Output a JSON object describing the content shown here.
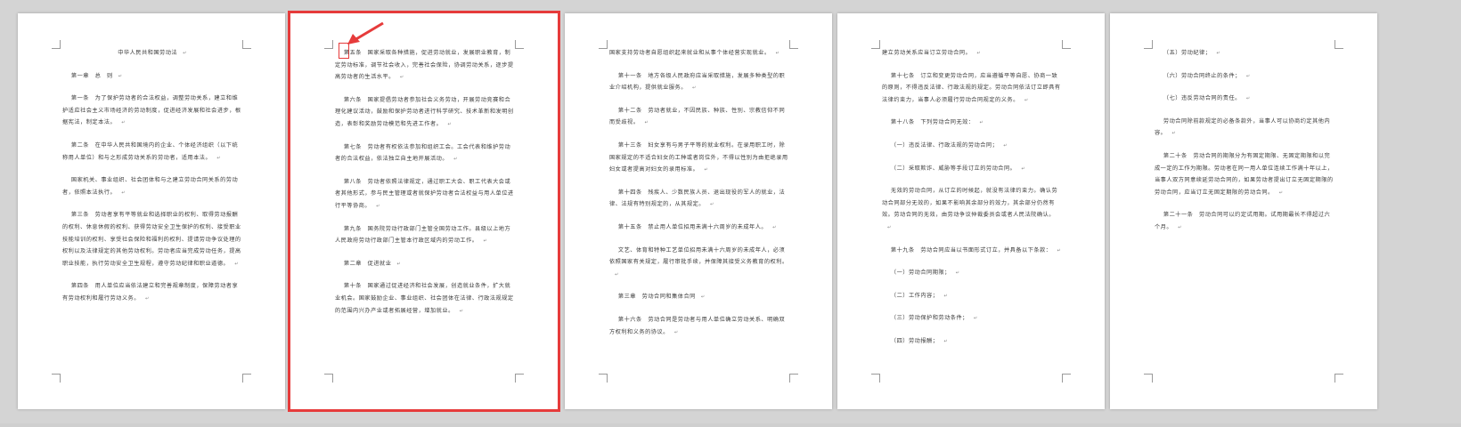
{
  "pages": [
    {
      "paragraphs": [
        "中华人民共和国劳动法",
        "第一章　总　则",
        "第一条　为了保护劳动者的合法权益，调整劳动关系，建立和维护适应社会主义市场经济的劳动制度，促进经济发展和社会进步，根据宪法，制定本法。",
        "第二条　在中华人民共和国境内的企业、个体经济组织（以下统称用人单位）和与之形成劳动关系的劳动者，适用本法。",
        "国家机关、事业组织、社会团体和与之建立劳动合同关系的劳动者，依照本法执行。",
        "第三条　劳动者享有平等就业和选择职业的权利、取得劳动报酬的权利、休息休假的权利、获得劳动安全卫生保护的权利、接受职业技能培训的权利、享受社会保险和福利的权利、提请劳动争议处理的权利以及法律规定的其他劳动权利。劳动者应当完成劳动任务，提高职业技能，执行劳动安全卫生规程，遵守劳动纪律和职业道德。",
        "第四条　用人单位应当依法建立和完善规章制度，保障劳动者享有劳动权利和履行劳动义务。"
      ]
    },
    {
      "paragraphs": [
        "第五条　国家采取各种措施，促进劳动就业，发展职业教育，制定劳动标准，调节社会收入，完善社会保险，协调劳动关系，逐步提高劳动者的生活水平。",
        "第六条　国家提倡劳动者参加社会义务劳动，开展劳动竞赛和合理化建议活动，鼓励和保护劳动者进行科学研究、技术革新和发明创造，表彰和奖励劳动模范和先进工作者。",
        "第七条　劳动者有权依法参加和组织工会。工会代表和维护劳动者的合法权益，依法独立自主地开展活动。",
        "第八条　劳动者依照法律规定，通过职工大会、职工代表大会或者其他形式，参与民主管理或者就保护劳动者合法权益与用人单位进行平等协商。",
        "第九条　国务院劳动行政部门主管全国劳动工作。县级以上地方人民政府劳动行政部门主管本行政区域内的劳动工作。",
        "第二章　促进就业",
        "第十条　国家通过促进经济和社会发展，创造就业条件，扩大就业机会。国家鼓励企业、事业组织、社会团体在法律、行政法规规定的范围内兴办产业或者拓展经营，增加就业。"
      ]
    },
    {
      "paragraphs": [
        "国家支持劳动者自愿组织起来就业和从事个体经营实现就业。",
        "第十一条　地方各级人民政府应当采取措施，发展多种类型的职业介绍机构，提供就业服务。",
        "第十二条　劳动者就业，不因民族、种族、性别、宗教信仰不同而受歧视。",
        "第十三条　妇女享有与男子平等的就业权利。在录用职工时，除国家规定的不适合妇女的工种或者岗位外，不得以性别为由拒绝录用妇女或者提高对妇女的录用标准。",
        "第十四条　残疾人、少数民族人员、退出现役的军人的就业，法律、法规有特别规定的，从其规定。",
        "第十五条　禁止用人单位招用未满十六周岁的未成年人。",
        "文艺、体育和特种工艺单位招用未满十六周岁的未成年人，必须依照国家有关规定，履行审批手续，并保障其接受义务教育的权利。",
        "第三章　劳动合同和集体合同",
        "第十六条　劳动合同是劳动者与用人单位确立劳动关系、明确双方权利和义务的协议。"
      ]
    },
    {
      "paragraphs": [
        "建立劳动关系应当订立劳动合同。",
        "第十七条　订立和变更劳动合同，应当遵循平等自愿、协商一致的原则，不得违反法律、行政法规的规定。劳动合同依法订立即具有法律约束力，当事人必须履行劳动合同规定的义务。",
        "第十八条　下列劳动合同无效：",
        "（一）违反法律、行政法规的劳动合同；",
        "（二）采取欺诈、威胁等手段订立的劳动合同。",
        "无效的劳动合同，从订立的时候起，就没有法律约束力。确认劳动合同部分无效的，如果不影响其余部分的效力，其余部分仍然有效。劳动合同的无效，由劳动争议仲裁委员会或者人民法院确认。",
        "第十九条　劳动合同应当以书面形式订立，并具备以下条款：",
        "（一）劳动合同期限；",
        "（二）工作内容；",
        "（三）劳动保护和劳动条件；",
        "（四）劳动报酬；"
      ]
    },
    {
      "paragraphs": [
        "（五）劳动纪律；",
        "（六）劳动合同终止的条件；",
        "（七）违反劳动合同的责任。",
        "劳动合同除前款规定的必备条款外，当事人可以协商约定其他内容。",
        "第二十条　劳动合同的期限分为有固定期限、无固定期限和以完成一定的工作为期限。劳动者在同一用人单位连续工作满十年以上，当事人双方同意续延劳动合同的，如果劳动者提出订立无固定期限的劳动合同，应当订立无固定期限的劳动合同。",
        "第二十一条　劳动合同可以约定试用期。试用期最长不得超过六个月。"
      ]
    }
  ],
  "paragraph_mark": "↵"
}
